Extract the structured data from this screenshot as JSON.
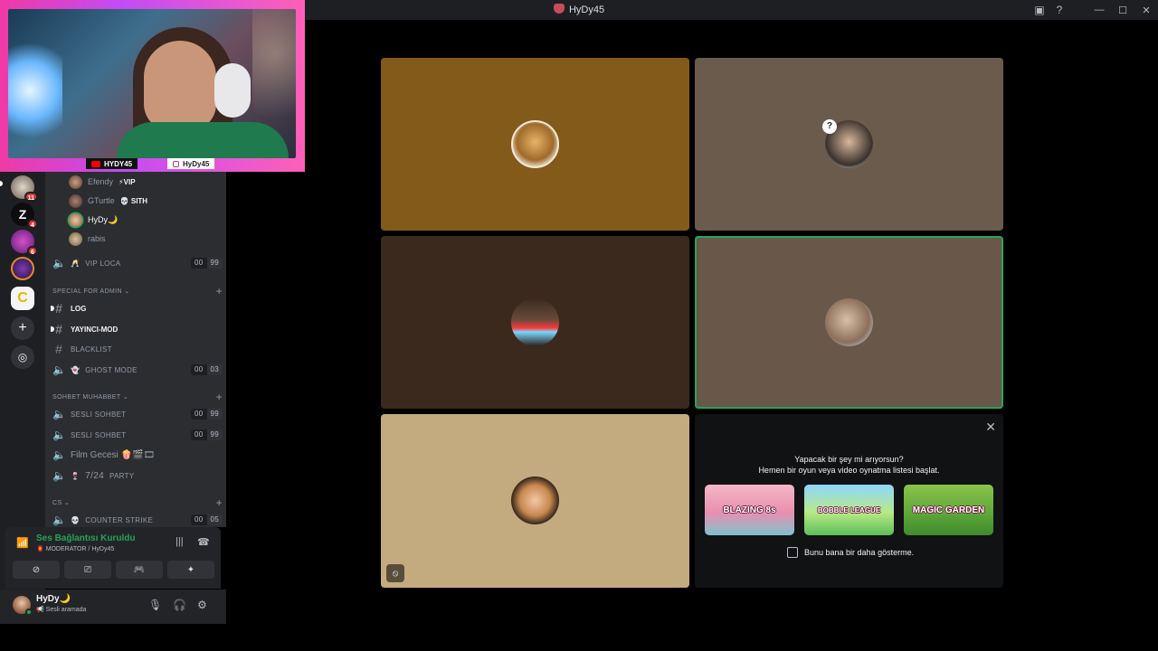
{
  "window": {
    "title": "HyDy45",
    "icons": [
      "inbox-icon",
      "help-icon"
    ],
    "controls": [
      "minimize",
      "maximize",
      "close"
    ]
  },
  "webcam": {
    "youtube_handle": "HYDY45",
    "instagram_handle": "HyDy45",
    "accent": "#f03aa6"
  },
  "servers": [
    {
      "name": "server-1",
      "badge": "11"
    },
    {
      "name": "server-2",
      "badge": "4"
    },
    {
      "name": "server-3",
      "badge": "6"
    },
    {
      "name": "server-4",
      "badge": ""
    },
    {
      "name": "server-active",
      "badge": ""
    }
  ],
  "voice_members": [
    {
      "name": "Efendy",
      "tag": "⚡VIP"
    },
    {
      "name": "GTurtle",
      "tag": "💀 SITH"
    },
    {
      "name": "HyDy🌙",
      "tag": ""
    },
    {
      "name": "rabis",
      "tag": ""
    }
  ],
  "channels": {
    "vip_loca": {
      "icon": "🥂",
      "name": "VIP LOCA",
      "users": "00",
      "limit": "99"
    },
    "cat_admin": "SPECIAL FOR ADMIN",
    "log": "LOG",
    "yayinci_mod": "YAYINCI-MOD",
    "blacklist": "BLACKLIST",
    "ghost_mode": {
      "icon": "👻",
      "name": "GHOST MODE",
      "users": "00",
      "limit": "03"
    },
    "cat_sohbet": "SOHBET MUHABBET",
    "sesli_1": {
      "name": "SESLI SOHBET",
      "users": "00",
      "limit": "99"
    },
    "sesli_2": {
      "name": "SESLI SOHBET",
      "users": "00",
      "limit": "99"
    },
    "film": {
      "name": "Film Gecesi 🍿🎬🎞"
    },
    "party": {
      "icon": "🍷",
      "name": "7/24",
      "suffix": "PARTY"
    },
    "cat_cs": "CS",
    "counter": {
      "icon": "💀",
      "name": "COUNTER STRIKE",
      "users": "00",
      "limit": "05"
    }
  },
  "voice_panel": {
    "status": "Ses Bağlantısı Kuruldu",
    "sub": "🏮 MODERATOR / HyDy45"
  },
  "user_panel": {
    "name": "HyDy🌙",
    "status": "📢 Sesli aramada"
  },
  "activity": {
    "line1": "Yapacak bir şey mi arıyorsun?",
    "line2": "Hemen bir oyun veya video oynatma listesi başlat.",
    "games": [
      {
        "title": "BLAZING 8s"
      },
      {
        "title": "BOBBLE LEAGUE"
      },
      {
        "title": "MAGIC GARDEN"
      }
    ],
    "checkbox_label": "Bunu bana bir daha gösterme."
  },
  "colors": {
    "online": "#23a55a",
    "badge": "#da373c",
    "tile_1": "#845a1a",
    "tile_2": "#6b5b4d",
    "tile_3": "#3b291e",
    "tile_4": "#695749",
    "tile_5": "#c4aa7f"
  }
}
